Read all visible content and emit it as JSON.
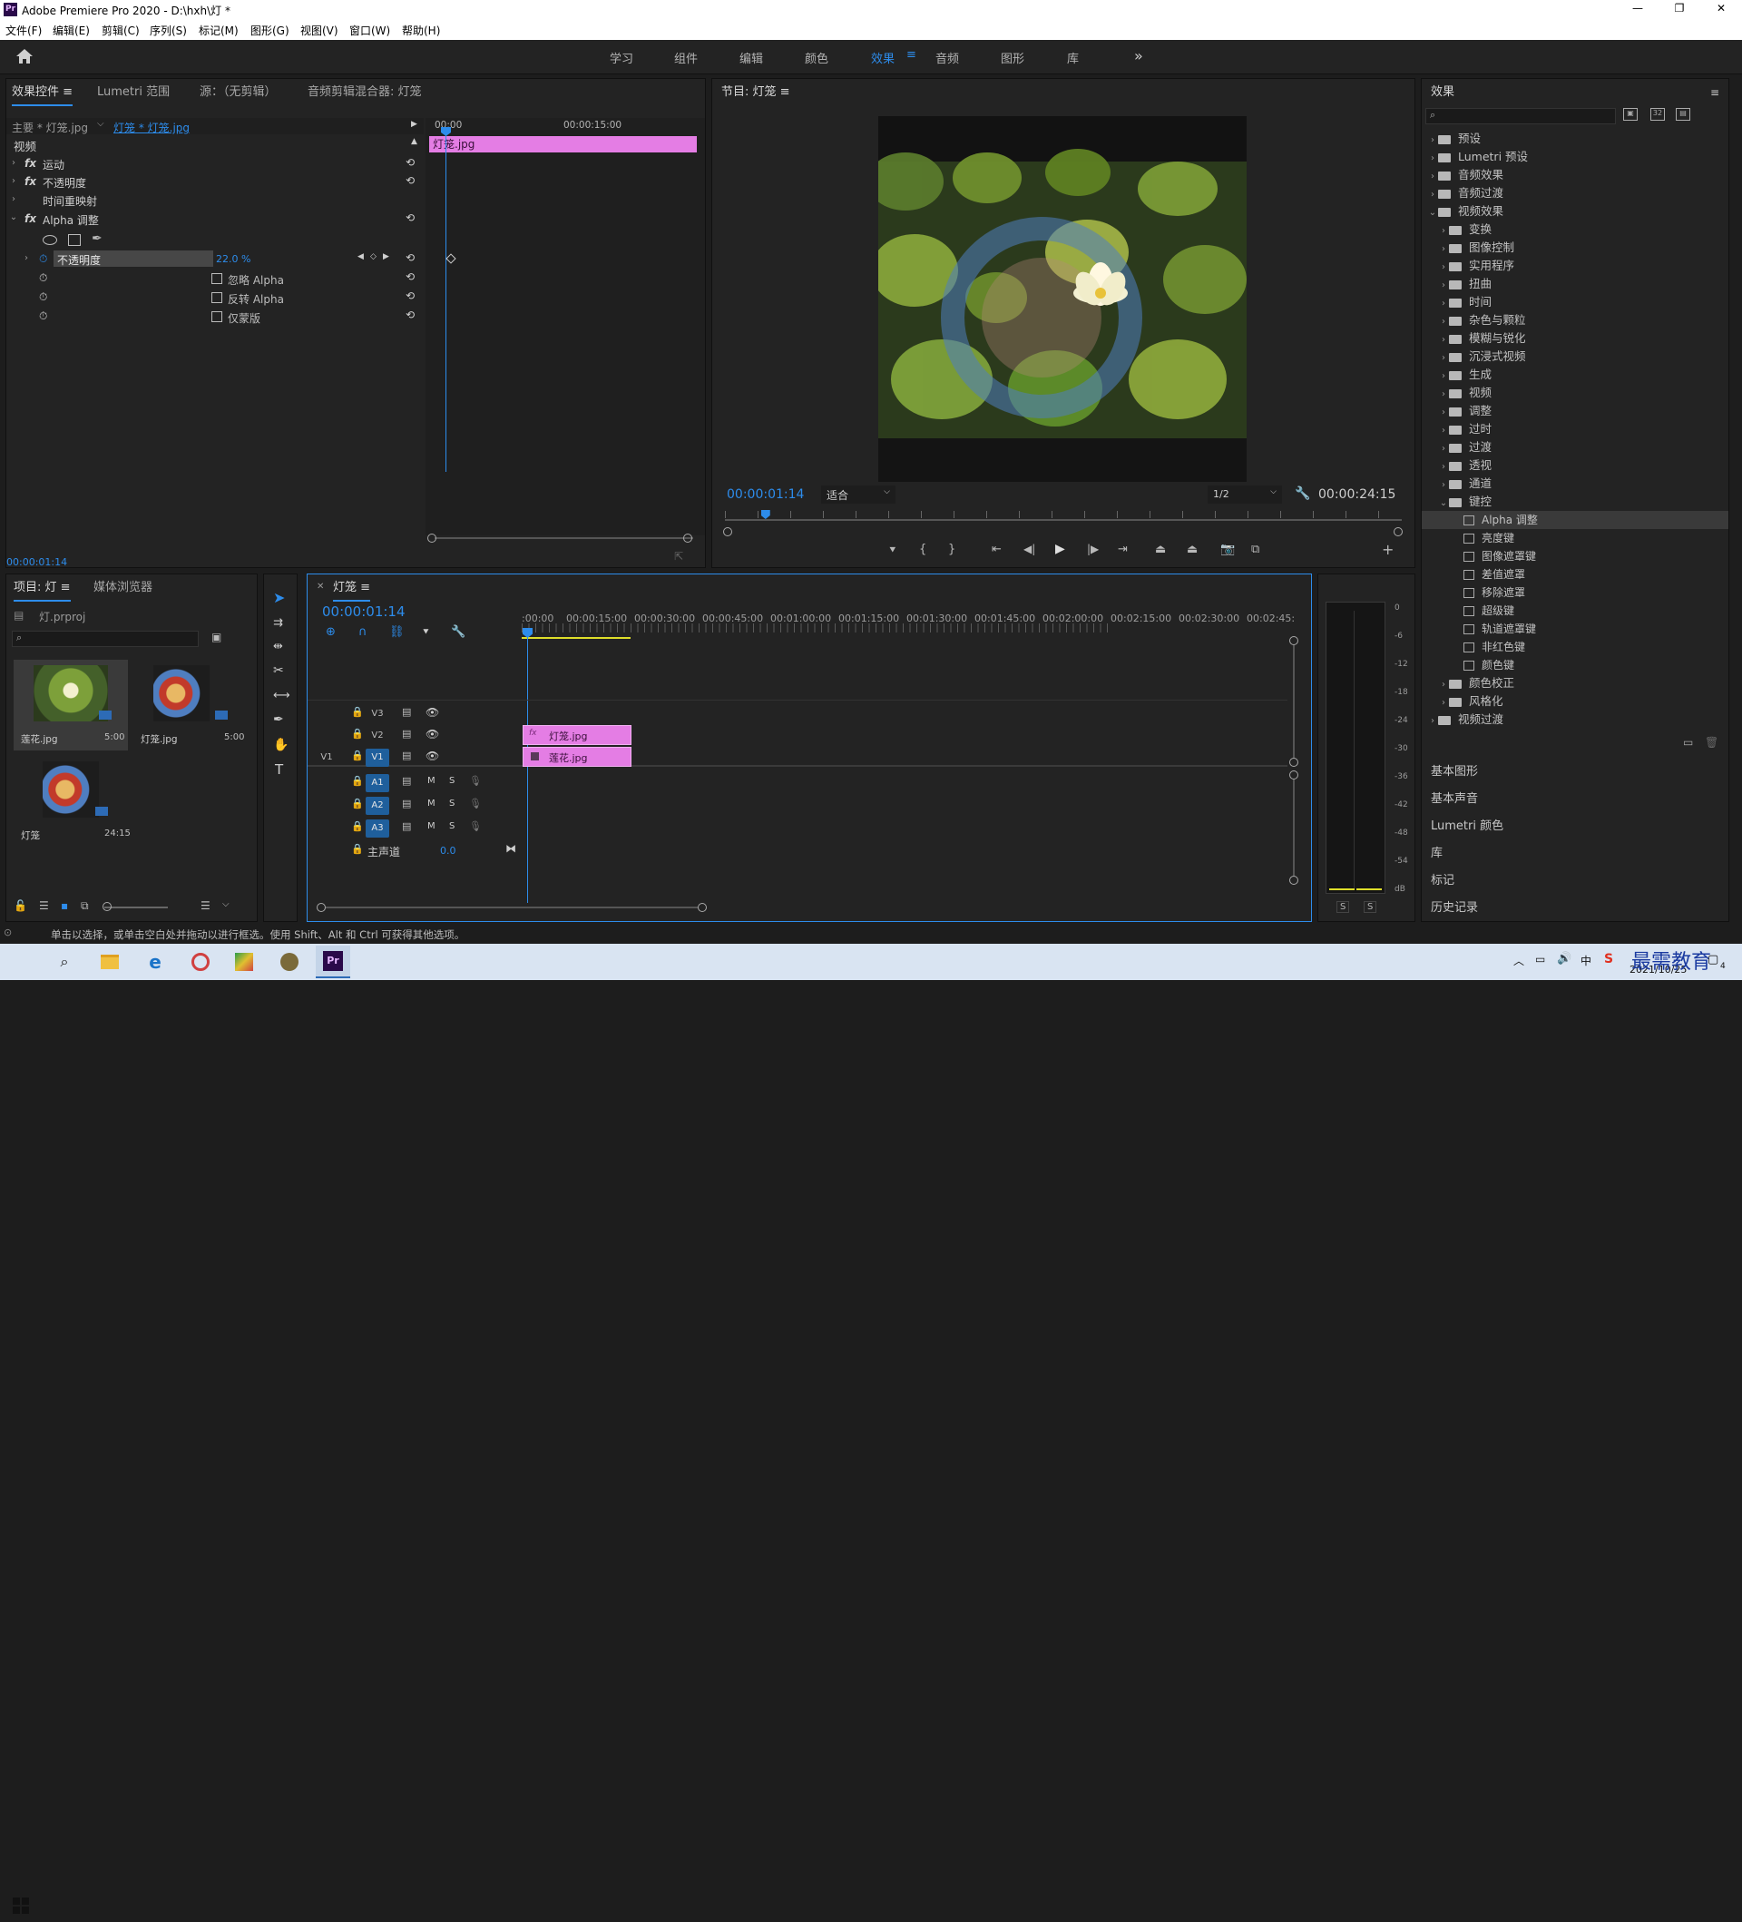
{
  "window": {
    "title": "Adobe Premiere Pro 2020 - D:\\hxh\\灯 *",
    "controls": [
      "—",
      "❐",
      "✕"
    ]
  },
  "menu": [
    "文件(F)",
    "编辑(E)",
    "剪辑(C)",
    "序列(S)",
    "标记(M)",
    "图形(G)",
    "视图(V)",
    "窗口(W)",
    "帮助(H)"
  ],
  "workspaces": {
    "items": [
      "学习",
      "组件",
      "编辑",
      "颜色",
      "效果",
      "音频",
      "图形",
      "库"
    ],
    "active": "效果",
    "more": "»"
  },
  "effect_controls": {
    "tabs": [
      "效果控件",
      "Lumetri 范围",
      "源：（无剪辑）",
      "音频剪辑混合器: 灯笼"
    ],
    "master_clip": "主要 * 灯笼.jpg",
    "sequence_clip": "灯笼 * 灯笼.jpg",
    "section": "视频",
    "ruler": [
      "00:00",
      "00:00:15:00"
    ],
    "clip_bar": "灯笼.jpg",
    "fx_rows": [
      {
        "name": "运动",
        "fx": "fx"
      },
      {
        "name": "不透明度",
        "fx": "fx"
      },
      {
        "name": "时间重映射",
        "fx": ""
      },
      {
        "name": "Alpha 调整",
        "fx": "fx"
      }
    ],
    "opacity_param": {
      "name": "不透明度",
      "value": "22.0 %"
    },
    "checkboxes": [
      "忽略 Alpha",
      "反转 Alpha",
      "仅蒙版"
    ],
    "timecode": "00:00:01:14"
  },
  "program": {
    "title": "节目: 灯笼",
    "timecode": "00:00:01:14",
    "fit": "适合",
    "resolution": "1/2",
    "duration": "00:00:24:15",
    "playhead_fraction": 0.06
  },
  "effects_panel": {
    "title": "效果",
    "search_placeholder": "",
    "tree": [
      {
        "label": "预设",
        "type": "folder-special",
        "indent": 0,
        "open": false
      },
      {
        "label": "Lumetri 预设",
        "type": "folder-special",
        "indent": 0,
        "open": false
      },
      {
        "label": "音频效果",
        "type": "folder",
        "indent": 0,
        "open": false
      },
      {
        "label": "音频过渡",
        "type": "folder",
        "indent": 0,
        "open": false
      },
      {
        "label": "视频效果",
        "type": "folder",
        "indent": 0,
        "open": true
      },
      {
        "label": "变换",
        "type": "folder",
        "indent": 1,
        "open": false
      },
      {
        "label": "图像控制",
        "type": "folder",
        "indent": 1,
        "open": false
      },
      {
        "label": "实用程序",
        "type": "folder",
        "indent": 1,
        "open": false
      },
      {
        "label": "扭曲",
        "type": "folder",
        "indent": 1,
        "open": false
      },
      {
        "label": "时间",
        "type": "folder",
        "indent": 1,
        "open": false
      },
      {
        "label": "杂色与颗粒",
        "type": "folder",
        "indent": 1,
        "open": false
      },
      {
        "label": "模糊与锐化",
        "type": "folder",
        "indent": 1,
        "open": false
      },
      {
        "label": "沉浸式视频",
        "type": "folder",
        "indent": 1,
        "open": false
      },
      {
        "label": "生成",
        "type": "folder",
        "indent": 1,
        "open": false
      },
      {
        "label": "视频",
        "type": "folder",
        "indent": 1,
        "open": false
      },
      {
        "label": "调整",
        "type": "folder",
        "indent": 1,
        "open": false
      },
      {
        "label": "过时",
        "type": "folder",
        "indent": 1,
        "open": false
      },
      {
        "label": "过渡",
        "type": "folder",
        "indent": 1,
        "open": false
      },
      {
        "label": "透视",
        "type": "folder",
        "indent": 1,
        "open": false
      },
      {
        "label": "通道",
        "type": "folder",
        "indent": 1,
        "open": false
      },
      {
        "label": "键控",
        "type": "folder",
        "indent": 1,
        "open": true
      },
      {
        "label": "Alpha 调整",
        "type": "effect",
        "indent": 2,
        "selected": true
      },
      {
        "label": "亮度键",
        "type": "effect",
        "indent": 2
      },
      {
        "label": "图像遮罩键",
        "type": "effect",
        "indent": 2
      },
      {
        "label": "差值遮罩",
        "type": "effect",
        "indent": 2
      },
      {
        "label": "移除遮罩",
        "type": "effect",
        "indent": 2
      },
      {
        "label": "超级键",
        "type": "effect",
        "indent": 2
      },
      {
        "label": "轨道遮罩键",
        "type": "effect",
        "indent": 2
      },
      {
        "label": "非红色键",
        "type": "effect",
        "indent": 2
      },
      {
        "label": "颜色键",
        "type": "effect",
        "indent": 2
      },
      {
        "label": "颜色校正",
        "type": "folder",
        "indent": 1,
        "open": false
      },
      {
        "label": "风格化",
        "type": "folder",
        "indent": 1,
        "open": false
      },
      {
        "label": "视频过渡",
        "type": "folder",
        "indent": 0,
        "open": false
      }
    ],
    "sub_panels": [
      "基本图形",
      "基本声音",
      "Lumetri 颜色",
      "库",
      "标记",
      "历史记录"
    ]
  },
  "project": {
    "tabs": [
      "项目: 灯",
      "媒体浏览器"
    ],
    "file": "灯.prproj",
    "items": [
      {
        "name": "莲花.jpg",
        "duration": "5:00"
      },
      {
        "name": "灯笼.jpg",
        "duration": "5:00"
      },
      {
        "name": "灯笼",
        "duration": "24:15"
      }
    ]
  },
  "timeline": {
    "title": "灯笼",
    "timecode": "00:00:01:14",
    "ruler": [
      ":00:00",
      "00:00:15:00",
      "00:00:30:00",
      "00:00:45:00",
      "00:01:00:00",
      "00:01:15:00",
      "00:01:30:00",
      "00:01:45:00",
      "00:02:00:00",
      "00:02:15:00",
      "00:02:30:00",
      "00:02:45:"
    ],
    "video_tracks": [
      "V3",
      "V2",
      "V1"
    ],
    "source_patch": "V1",
    "audio_tracks": [
      "A1",
      "A2",
      "A3"
    ],
    "master": {
      "label": "主声道",
      "value": "0.0"
    },
    "clips": [
      {
        "name": "灯笼.jpg",
        "track": "V2",
        "fx": "fx"
      },
      {
        "name": "莲花.jpg",
        "track": "V1",
        "fx": ""
      }
    ],
    "audio_buttons": [
      "M",
      "S"
    ]
  },
  "audio_meter": {
    "scale": [
      "0",
      "-6",
      "-12",
      "-18",
      "-24",
      "-30",
      "-36",
      "-42",
      "-48",
      "-54",
      "dB"
    ],
    "solo": [
      "S",
      "S"
    ]
  },
  "status_bar": "单击以选择，或单击空白处并拖动以进行框选。使用 Shift、Alt 和 Ctrl 可获得其他选项。",
  "taskbar": {
    "date": "2021/10/25",
    "ime": "中",
    "watermark": "最需教育",
    "badge": "4"
  },
  "colors": {
    "accent": "#2d8ceb",
    "clip_pink": "#e47de4",
    "panel_bg": "#232323",
    "dark_bg": "#1d1d1d"
  }
}
